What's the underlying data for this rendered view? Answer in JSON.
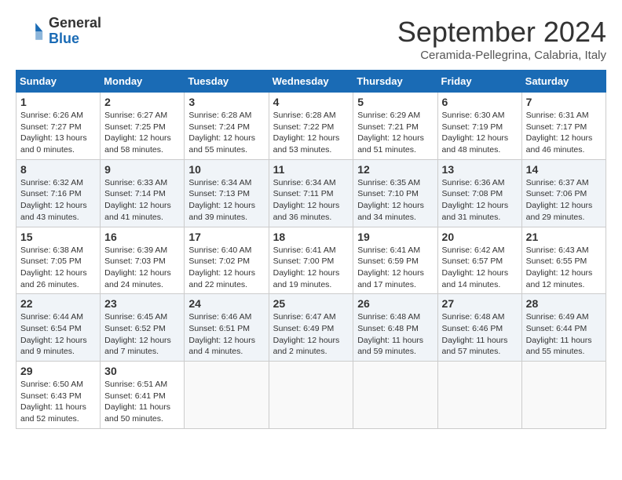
{
  "header": {
    "logo_general": "General",
    "logo_blue": "Blue",
    "month_title": "September 2024",
    "subtitle": "Ceramida-Pellegrina, Calabria, Italy"
  },
  "weekdays": [
    "Sunday",
    "Monday",
    "Tuesday",
    "Wednesday",
    "Thursday",
    "Friday",
    "Saturday"
  ],
  "weeks": [
    [
      {
        "day": "1",
        "info": "Sunrise: 6:26 AM\nSunset: 7:27 PM\nDaylight: 13 hours\nand 0 minutes."
      },
      {
        "day": "2",
        "info": "Sunrise: 6:27 AM\nSunset: 7:25 PM\nDaylight: 12 hours\nand 58 minutes."
      },
      {
        "day": "3",
        "info": "Sunrise: 6:28 AM\nSunset: 7:24 PM\nDaylight: 12 hours\nand 55 minutes."
      },
      {
        "day": "4",
        "info": "Sunrise: 6:28 AM\nSunset: 7:22 PM\nDaylight: 12 hours\nand 53 minutes."
      },
      {
        "day": "5",
        "info": "Sunrise: 6:29 AM\nSunset: 7:21 PM\nDaylight: 12 hours\nand 51 minutes."
      },
      {
        "day": "6",
        "info": "Sunrise: 6:30 AM\nSunset: 7:19 PM\nDaylight: 12 hours\nand 48 minutes."
      },
      {
        "day": "7",
        "info": "Sunrise: 6:31 AM\nSunset: 7:17 PM\nDaylight: 12 hours\nand 46 minutes."
      }
    ],
    [
      {
        "day": "8",
        "info": "Sunrise: 6:32 AM\nSunset: 7:16 PM\nDaylight: 12 hours\nand 43 minutes."
      },
      {
        "day": "9",
        "info": "Sunrise: 6:33 AM\nSunset: 7:14 PM\nDaylight: 12 hours\nand 41 minutes."
      },
      {
        "day": "10",
        "info": "Sunrise: 6:34 AM\nSunset: 7:13 PM\nDaylight: 12 hours\nand 39 minutes."
      },
      {
        "day": "11",
        "info": "Sunrise: 6:34 AM\nSunset: 7:11 PM\nDaylight: 12 hours\nand 36 minutes."
      },
      {
        "day": "12",
        "info": "Sunrise: 6:35 AM\nSunset: 7:10 PM\nDaylight: 12 hours\nand 34 minutes."
      },
      {
        "day": "13",
        "info": "Sunrise: 6:36 AM\nSunset: 7:08 PM\nDaylight: 12 hours\nand 31 minutes."
      },
      {
        "day": "14",
        "info": "Sunrise: 6:37 AM\nSunset: 7:06 PM\nDaylight: 12 hours\nand 29 minutes."
      }
    ],
    [
      {
        "day": "15",
        "info": "Sunrise: 6:38 AM\nSunset: 7:05 PM\nDaylight: 12 hours\nand 26 minutes."
      },
      {
        "day": "16",
        "info": "Sunrise: 6:39 AM\nSunset: 7:03 PM\nDaylight: 12 hours\nand 24 minutes."
      },
      {
        "day": "17",
        "info": "Sunrise: 6:40 AM\nSunset: 7:02 PM\nDaylight: 12 hours\nand 22 minutes."
      },
      {
        "day": "18",
        "info": "Sunrise: 6:41 AM\nSunset: 7:00 PM\nDaylight: 12 hours\nand 19 minutes."
      },
      {
        "day": "19",
        "info": "Sunrise: 6:41 AM\nSunset: 6:59 PM\nDaylight: 12 hours\nand 17 minutes."
      },
      {
        "day": "20",
        "info": "Sunrise: 6:42 AM\nSunset: 6:57 PM\nDaylight: 12 hours\nand 14 minutes."
      },
      {
        "day": "21",
        "info": "Sunrise: 6:43 AM\nSunset: 6:55 PM\nDaylight: 12 hours\nand 12 minutes."
      }
    ],
    [
      {
        "day": "22",
        "info": "Sunrise: 6:44 AM\nSunset: 6:54 PM\nDaylight: 12 hours\nand 9 minutes."
      },
      {
        "day": "23",
        "info": "Sunrise: 6:45 AM\nSunset: 6:52 PM\nDaylight: 12 hours\nand 7 minutes."
      },
      {
        "day": "24",
        "info": "Sunrise: 6:46 AM\nSunset: 6:51 PM\nDaylight: 12 hours\nand 4 minutes."
      },
      {
        "day": "25",
        "info": "Sunrise: 6:47 AM\nSunset: 6:49 PM\nDaylight: 12 hours\nand 2 minutes."
      },
      {
        "day": "26",
        "info": "Sunrise: 6:48 AM\nSunset: 6:48 PM\nDaylight: 11 hours\nand 59 minutes."
      },
      {
        "day": "27",
        "info": "Sunrise: 6:48 AM\nSunset: 6:46 PM\nDaylight: 11 hours\nand 57 minutes."
      },
      {
        "day": "28",
        "info": "Sunrise: 6:49 AM\nSunset: 6:44 PM\nDaylight: 11 hours\nand 55 minutes."
      }
    ],
    [
      {
        "day": "29",
        "info": "Sunrise: 6:50 AM\nSunset: 6:43 PM\nDaylight: 11 hours\nand 52 minutes."
      },
      {
        "day": "30",
        "info": "Sunrise: 6:51 AM\nSunset: 6:41 PM\nDaylight: 11 hours\nand 50 minutes."
      },
      {
        "day": "",
        "info": ""
      },
      {
        "day": "",
        "info": ""
      },
      {
        "day": "",
        "info": ""
      },
      {
        "day": "",
        "info": ""
      },
      {
        "day": "",
        "info": ""
      }
    ]
  ]
}
